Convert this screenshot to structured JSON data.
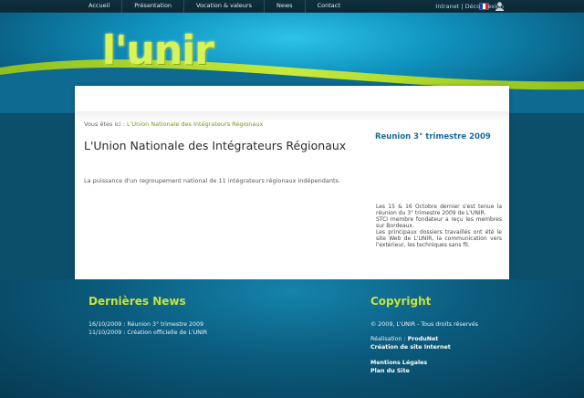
{
  "nav": {
    "items": [
      "Accueil",
      "Présentation",
      "Vocation & valeurs",
      "News",
      "Contact"
    ]
  },
  "toplinks": {
    "intranet": "Intranet",
    "separator": "|",
    "logout": "Déconnexion"
  },
  "icons": {
    "flag": "france-flag-icon",
    "user": "user-icon"
  },
  "header": {
    "logo": "l'unir"
  },
  "breadcrumb": {
    "prefix": "Vous êtes ici :",
    "current": "L'Union Nationale des Intégrateurs Régionaux"
  },
  "main": {
    "title": "L'Union Nationale des Intégrateurs Régionaux",
    "intro": "La puissance d'un regroupement national de 11 intégrateurs régionaux indépendants."
  },
  "sidebar": {
    "title": "Reunion 3° trimestre 2009",
    "paragraphs": [
      "Les 15 & 16 Octobre dernier s'est tenue la réunion du 3° trimestre 2009 de L'UNIR.",
      "STCI membre fondateur a reçu les membres sur Bordeaux.",
      "Les principaux dossiers travaillés ont été le site Web de L'UNIR, la communication vers l'extérieur, les techniques sans fil."
    ]
  },
  "footer": {
    "news_title": "Dernières News",
    "news": [
      "16/10/2009 : Réunion 3° trimestre 2009",
      "11/10/2009 : Création officielle de L'UNIR"
    ],
    "copyright_title": "Copyright",
    "copyright_text": "© 2009, L'UNIR - Tous droits réservés",
    "realisation_label": "Réalisation :",
    "realisation_link": "ProduNet",
    "creation_link": "Création de site Internet",
    "legal_link": "Mentions Légales",
    "sitemap_link": "Plan du Site"
  },
  "colors": {
    "accent_green": "#c9e33a",
    "link_blue": "#1b6a98",
    "breadcrumb_green": "#6c9a1f"
  }
}
